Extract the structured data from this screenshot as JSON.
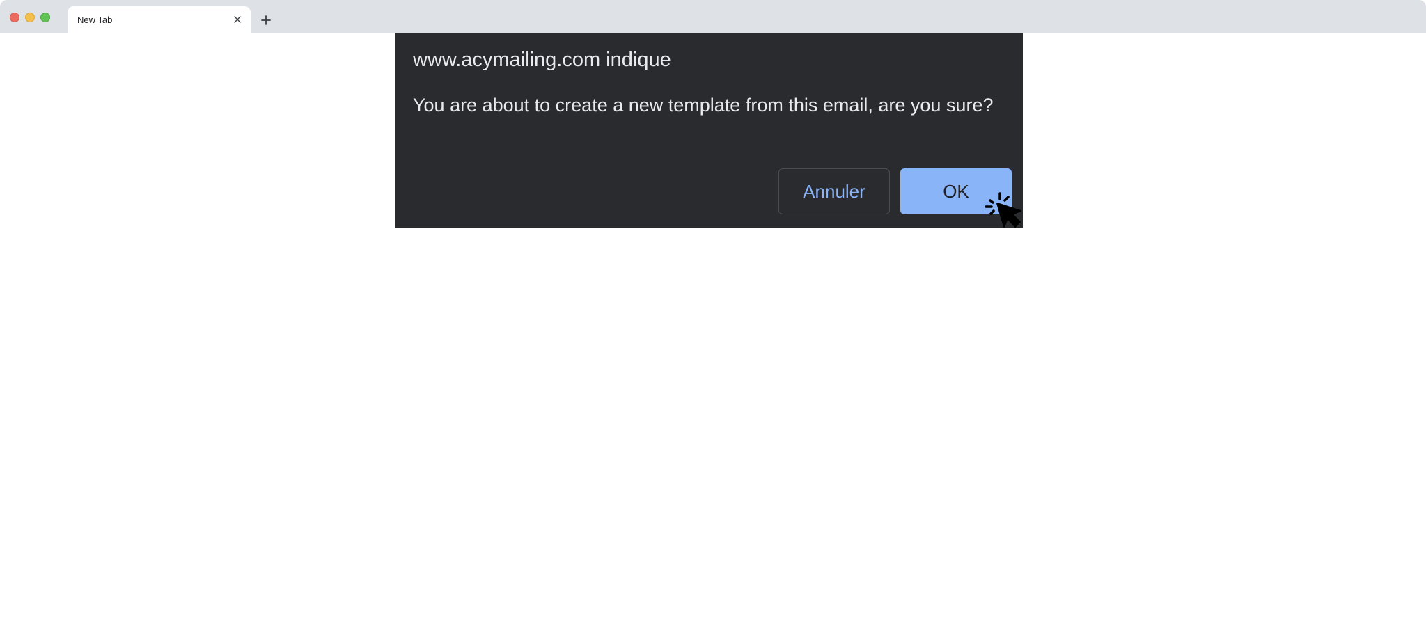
{
  "browser": {
    "tabs": [
      {
        "title": "New Tab"
      }
    ],
    "close_tab_icon": "close-icon",
    "new_tab_icon": "plus-icon"
  },
  "dialog": {
    "origin": "www.acymailing.com indique",
    "message": "You are about to create a new template from this email, are you sure?",
    "cancel_label": "Annuler",
    "ok_label": "OK"
  },
  "colors": {
    "dialog_background": "#2a2b2f",
    "accent": "#8ab4f8",
    "tabstrip": "#dee1e6"
  }
}
